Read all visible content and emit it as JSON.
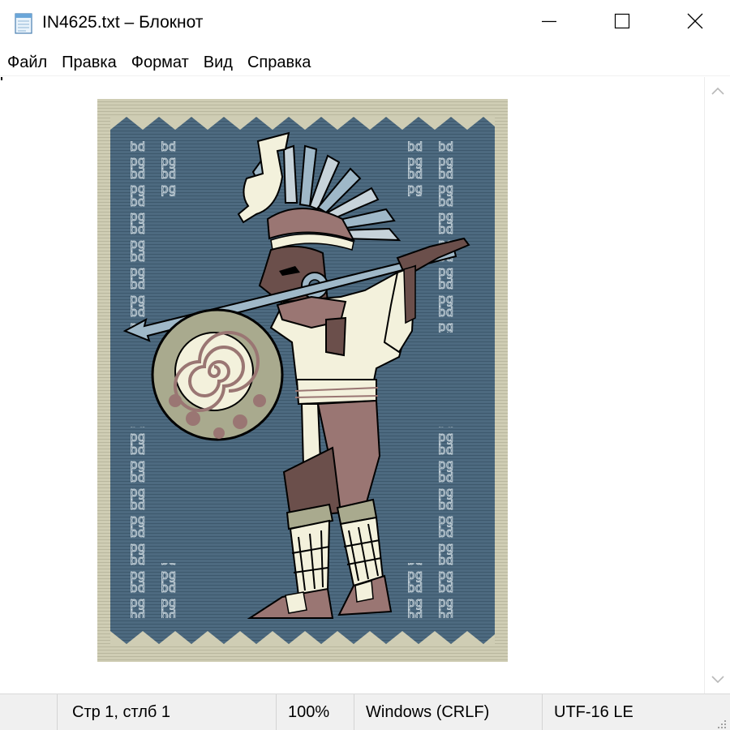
{
  "window": {
    "title": "IN4625.txt – Блокнот",
    "app_icon": "notepad-icon",
    "controls": {
      "minimize": "minimize-icon",
      "maximize": "maximize-icon",
      "close": "close-icon"
    }
  },
  "menu": {
    "items": [
      "Файл",
      "Правка",
      "Формат",
      "Вид",
      "Справка"
    ]
  },
  "editor": {
    "content_description_icon": "ascii-art-aztec-warrior",
    "colors": {
      "background_blue": "#4d6a80",
      "border_beige": "#cfcdb4",
      "skin_brown": "#6b4f4b",
      "cream": "#f3f1dc",
      "muted_green": "#a9aa8e",
      "pink_brown": "#9a7673",
      "outline": "#000000"
    }
  },
  "scrollbar": {
    "up": "chevron-up-icon",
    "down": "chevron-down-icon"
  },
  "status": {
    "position": "Стр 1, стлб 1",
    "zoom": "100%",
    "line_ending": "Windows (CRLF)",
    "encoding": "UTF-16 LE"
  }
}
